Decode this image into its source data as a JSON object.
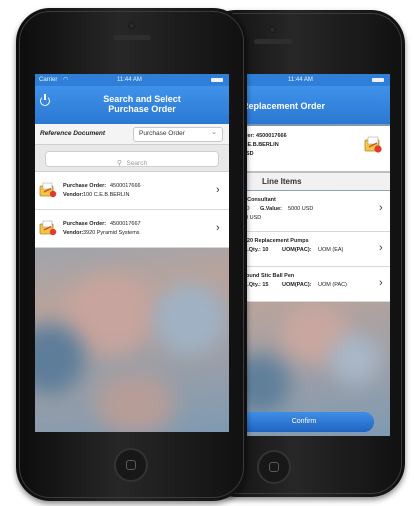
{
  "front": {
    "status": {
      "carrier": "Carrier",
      "time": "11:44 AM"
    },
    "title_line1": "Search and Select",
    "title_line2": "Purchase Order",
    "ref_label": "Reference Document",
    "ref_value": "Purchase Order",
    "search_placeholder": "Search",
    "orders": [
      {
        "po_label": "Purchase Order:",
        "po": "4500017666",
        "vendor_label": "Vendor:",
        "vendor": "100 C.E.B.BERLIN"
      },
      {
        "po_label": "Purchase Order:",
        "po": "4500017667",
        "vendor_label": "Vendor:",
        "vendor": "3920 Pyramid Systems"
      }
    ]
  },
  "back": {
    "status": {
      "time": "11:44 AM"
    },
    "title": "Replacement Order",
    "header": {
      "line1": "rder: 4500017666",
      "line2": "C.E.B.BERLIN",
      "line3": "USD"
    },
    "section": "Line Items",
    "items": [
      {
        "line1": "P Consultant",
        "line2a": "SD",
        "line2b_label": "G.Value:",
        "line2b": "5000 USD",
        "line3": "00 USD"
      },
      {
        "line1": "-520 Replacement Pumps",
        "line2a": "ut.Qty.: 10",
        "line2b_label": "UOM(PAC):",
        "line2b": "UOM (EA)"
      },
      {
        "line1": "Round Stic Ball Pen",
        "line2a": "ut.Qty.: 15",
        "line2b_label": "UOM(PAC):",
        "line2b": "UOM (PAC)"
      }
    ],
    "confirm_label": "Confirm"
  }
}
